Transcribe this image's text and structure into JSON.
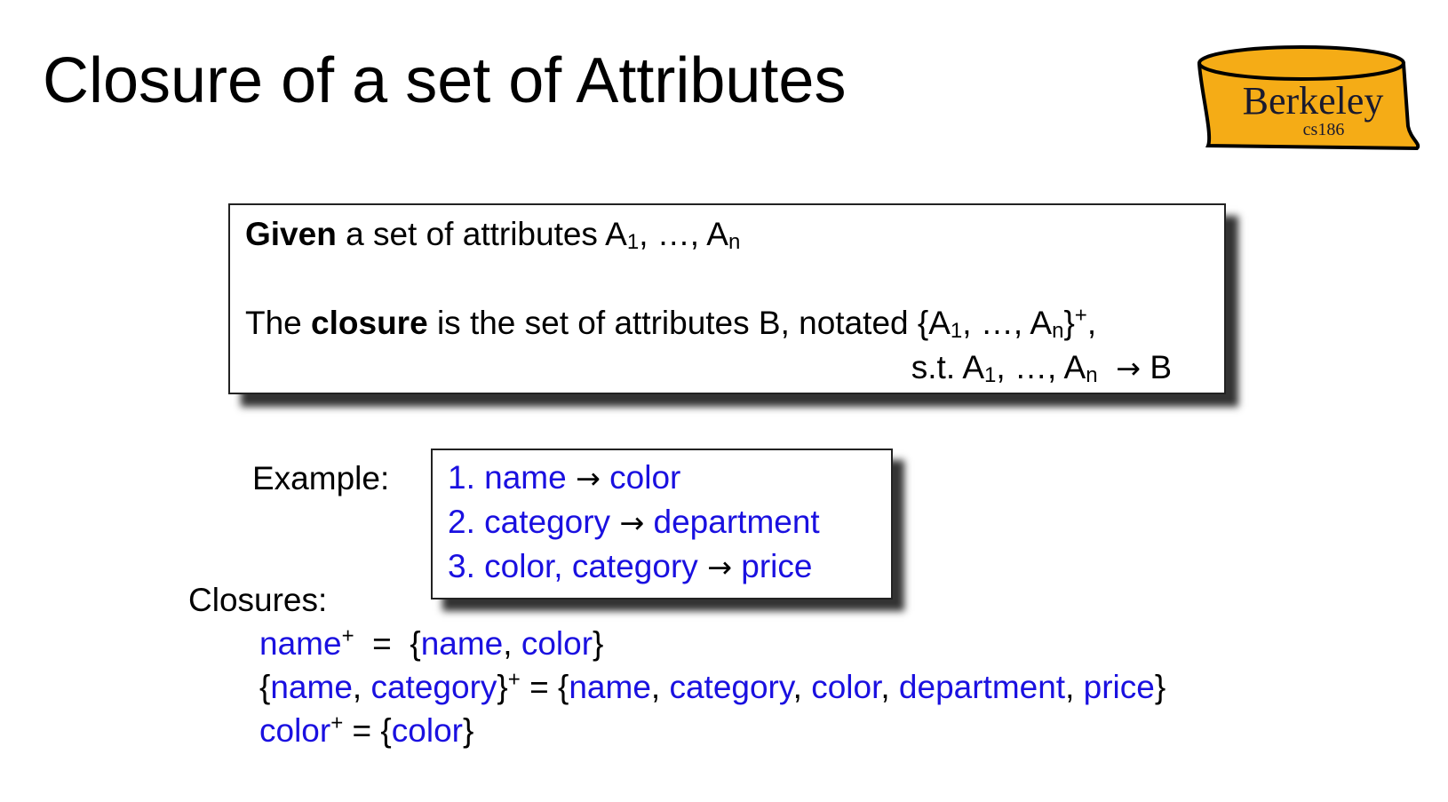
{
  "slide": {
    "title": "Closure of a set of Attributes"
  },
  "logo": {
    "text": "Berkeley",
    "subtext": "cs186",
    "fill_color": "#f5ac16"
  },
  "definition": {
    "given_bold": "Given",
    "given_rest": " a set of attributes  A",
    "given_sub1": "1",
    "given_mid": ", …, A",
    "given_subn": "n",
    "closure_pre": "The ",
    "closure_bold": "closure",
    "closure_rest": " is the set of attributes B, notated {A",
    "closure_sub1": "1",
    "closure_mid": ", …, A",
    "closure_subn": "n",
    "closure_brace": "}",
    "closure_sup": "+",
    "closure_comma": ",",
    "st_pre": "s.t. A",
    "st_sub1": "1",
    "st_mid": ", …, A",
    "st_subn": "n",
    "st_arrow": "→",
    "st_b": "B"
  },
  "example": {
    "label": "Example:",
    "fds": [
      {
        "num": "1. ",
        "lhs": "name",
        "arrow": "→",
        "rhs": "color"
      },
      {
        "num": "2. ",
        "lhs": "category",
        "arrow": "→",
        "rhs": "department"
      },
      {
        "num": "3. ",
        "lhs": "color, category",
        "arrow": "→",
        "rhs": "price"
      }
    ]
  },
  "closures": {
    "label": "Closures:",
    "line1": {
      "attr": "name",
      "sup": "+",
      "eq": "  =  {",
      "v1": "name",
      "sep1": ", ",
      "v2": "color",
      "close": "}"
    },
    "line2": {
      "open": "{",
      "a1": "name",
      "sep": ", ",
      "a2": "category",
      "close": "}",
      "sup": "+",
      "eq": " = {",
      "v1": "name",
      "s1": ", ",
      "v2": "category",
      "s2": ", ",
      "v3": "color",
      "s3": ", ",
      "v4": "department",
      "s4": ", ",
      "v5": "price",
      "end": "}"
    },
    "line3": {
      "attr": "color",
      "sup": "+",
      "eq": " = {",
      "v1": "color",
      "close": "}"
    }
  }
}
